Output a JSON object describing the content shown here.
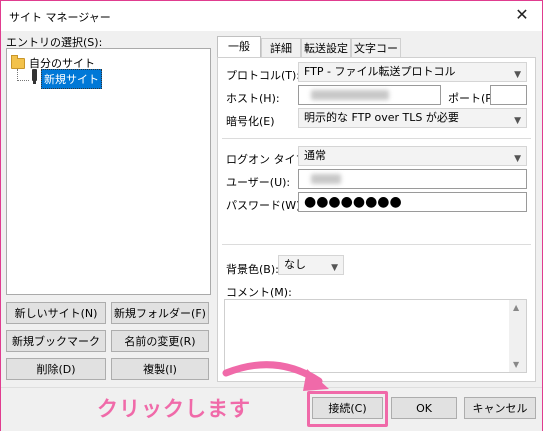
{
  "window": {
    "title": "サイト マネージャー",
    "close_glyph": "✕"
  },
  "sites": {
    "label": "エントリの選択(S):",
    "tree": {
      "root_label": "自分のサイト",
      "child_label": "新規サイト"
    }
  },
  "left_buttons": {
    "new_site": "新しいサイト(N)",
    "new_folder": "新規フォルダー(F)",
    "new_bookmark": "新規ブックマーク(M)",
    "rename": "名前の変更(R)",
    "delete": "削除(D)",
    "duplicate": "複製(I)"
  },
  "tabs": [
    "一般",
    "詳細",
    "転送設定",
    "文字コード"
  ],
  "general": {
    "protocol_label": "プロトコル(T):",
    "protocol_value": "FTP - ファイル転送プロトコル",
    "host_label": "ホスト(H):",
    "port_label": "ポート(P):",
    "port_value": "",
    "encryption_label": "暗号化(E)",
    "encryption_value": "明示的な FTP over TLS が必要",
    "logon_type_label": "ログオン タイプ(L):",
    "logon_type_value": "通常",
    "user_label": "ユーザー(U):",
    "password_label": "パスワード(W):",
    "password_mask": "●●●●●●●●",
    "bg_color_label": "背景色(B):",
    "bg_color_value": "なし",
    "comment_label": "コメント(M):"
  },
  "footer": {
    "connect": "接続(C)",
    "ok": "OK",
    "cancel": "キャンセル"
  },
  "annotation": {
    "text": "クリックします",
    "color": "#f06aa9"
  },
  "colors": {
    "selection": "#0078d7",
    "highlight": "#f06aa9",
    "folder": "#f3c24b"
  }
}
